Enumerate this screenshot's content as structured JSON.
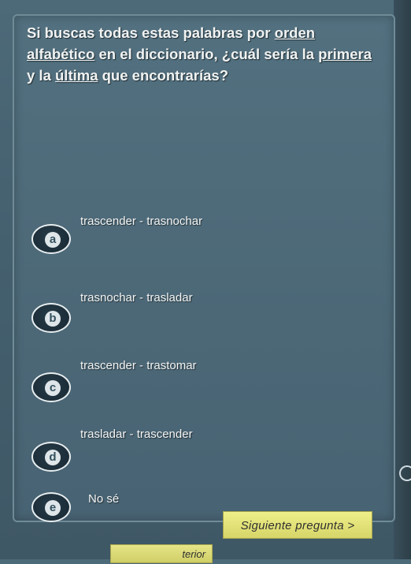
{
  "question": {
    "part1": "Si buscas todas estas palabras por ",
    "u1": "orden alfabético",
    "part2": " en el diccionario, ¿cuál sería la ",
    "u2": "primera",
    "part3": " y la ",
    "u3": "última",
    "part4": " que encontrarías?"
  },
  "options": [
    {
      "letter": "a",
      "text": "trascender - trasnochar"
    },
    {
      "letter": "b",
      "text": "trasnochar - trasladar"
    },
    {
      "letter": "c",
      "text": "trascender - trastomar"
    },
    {
      "letter": "d",
      "text": "trasladar - trascender"
    },
    {
      "letter": "e",
      "text": "No sé"
    }
  ],
  "nav": {
    "next_label": "Siguiente pregunta >",
    "prev_label": "terior"
  },
  "colors": {
    "background": "#4d6a79",
    "panel_border": "#6f8b98",
    "button": "#e6e57f",
    "badge": "#1c2e39"
  }
}
